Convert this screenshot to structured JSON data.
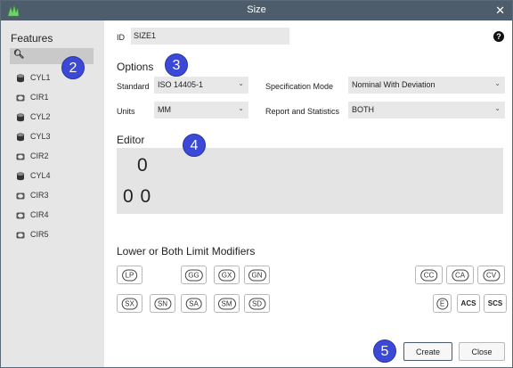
{
  "window": {
    "title": "Size"
  },
  "features": {
    "heading": "Features",
    "items": [
      {
        "label": "CYL1",
        "kind": "cylinder"
      },
      {
        "label": "CIR1",
        "kind": "circle"
      },
      {
        "label": "CYL2",
        "kind": "cylinder"
      },
      {
        "label": "CYL3",
        "kind": "cylinder"
      },
      {
        "label": "CIR2",
        "kind": "circle"
      },
      {
        "label": "CYL4",
        "kind": "cylinder"
      },
      {
        "label": "CIR3",
        "kind": "circle"
      },
      {
        "label": "CIR4",
        "kind": "circle"
      },
      {
        "label": "CIR5",
        "kind": "circle"
      }
    ]
  },
  "id": {
    "label": "ID",
    "value": "SIZE1"
  },
  "options": {
    "heading": "Options",
    "standard_label": "Standard",
    "standard_value": "ISO 14405-1",
    "units_label": "Units",
    "units_value": "MM",
    "spec_mode_label": "Specification Mode",
    "spec_mode_value": "Nominal With Deviation",
    "report_label": "Report and Statistics",
    "report_value": "BOTH"
  },
  "editor": {
    "heading": "Editor",
    "line1": "0",
    "line2": "0 0"
  },
  "modifiers": {
    "heading": "Lower or Both Limit Modifiers",
    "row1": [
      "LP",
      "GG",
      "GX",
      "GN",
      "CC",
      "CA",
      "CV"
    ],
    "row2": [
      "SX",
      "SN",
      "SA",
      "SM",
      "SD",
      "E",
      "ACS",
      "SCS"
    ]
  },
  "buttons": {
    "create": "Create",
    "close": "Close"
  },
  "callouts": [
    "2",
    "3",
    "4",
    "5"
  ],
  "colors": {
    "titlebar": "#4e5d6b",
    "callout": "#3b49d6",
    "editor_bg": "#e4e4e4"
  }
}
